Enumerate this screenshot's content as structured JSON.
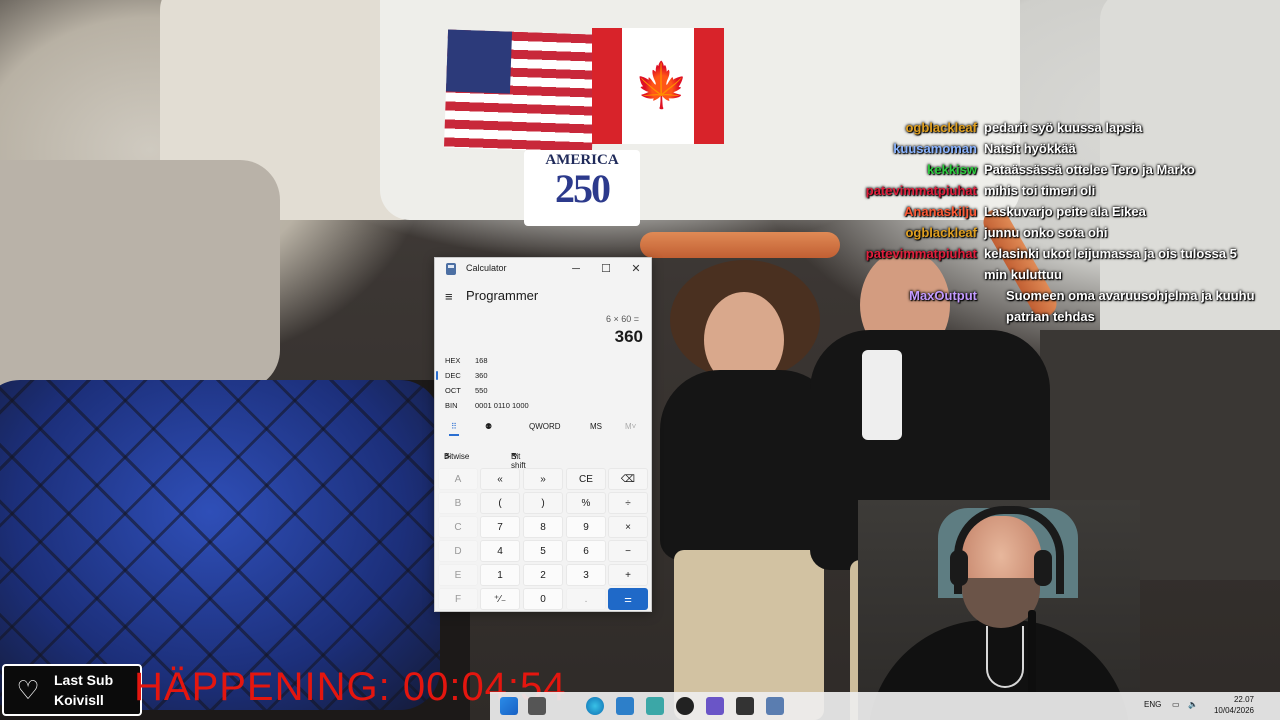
{
  "video": {
    "banner_line1": "AMERICA",
    "banner_line2": "250"
  },
  "chat": [
    {
      "user": "ogblackleaf",
      "color": "#e0a020",
      "text": "pedarit syö kuussa lapsia"
    },
    {
      "user": "kuusamoman",
      "color": "#8ab4ff",
      "text": "Natsit hyökkää"
    },
    {
      "user": "kekkisw",
      "color": "#2ecc40",
      "text": "Pataässässä ottelee Tero ja Marko"
    },
    {
      "user": "patevimmatpiuhat",
      "color": "#e01e3c",
      "text": "mihis toi timeri oli"
    },
    {
      "user": "Ananaskilju",
      "color": "#ff5a36",
      "text": "Laskuvarjo peite ala Eikea"
    },
    {
      "user": "ogblackleaf",
      "color": "#e0a020",
      "text": "junnu onko sota ohi"
    },
    {
      "user": "patevimmatpiuhat",
      "color": "#e01e3c",
      "text": "kelasinki ukot leijumassa ja ois tulossa 5",
      "text2": "min kuluttuu"
    },
    {
      "user": "MaxOutput",
      "color": "#c39bff",
      "text": "Suomeen oma avaruusohjelma ja kuuhu",
      "text2": "patrian tehdas"
    }
  ],
  "calculator": {
    "window_title": "Calculator",
    "minimize": "─",
    "maximize": "☐",
    "close": "✕",
    "menu_icon": "≡",
    "mode": "Programmer",
    "expression": "6 × 60 =",
    "result": "360",
    "bases": [
      {
        "label": "HEX",
        "value": "168"
      },
      {
        "label": "DEC",
        "value": "360"
      },
      {
        "label": "OCT",
        "value": "550"
      },
      {
        "label": "BIN",
        "value": "0001 0110 1000"
      }
    ],
    "keypad_icon": "⠿",
    "bitflip_icon": "⚉",
    "word_size": "QWORD",
    "memory_store": "MS",
    "memory_menu": "M˅",
    "bitwise": "Bitwise",
    "bitshift": "Bit shift",
    "keys": [
      [
        "A",
        "«",
        "»",
        "CE",
        "⌫"
      ],
      [
        "B",
        "(",
        ")",
        "%",
        "÷"
      ],
      [
        "C",
        "7",
        "8",
        "9",
        "×"
      ],
      [
        "D",
        "4",
        "5",
        "6",
        "−"
      ],
      [
        "E",
        "1",
        "2",
        "3",
        "+"
      ],
      [
        "F",
        "⁺∕₋",
        "0",
        ".",
        "="
      ]
    ]
  },
  "overlay": {
    "last_sub_title": "Last Sub",
    "last_sub_name": "Koivisll",
    "heart_icon": "♡",
    "happening": "HÄPPENING: 00:04:54"
  },
  "taskbar": {
    "lang": "ENG",
    "time": "22.07",
    "date": "10/04/2026"
  }
}
